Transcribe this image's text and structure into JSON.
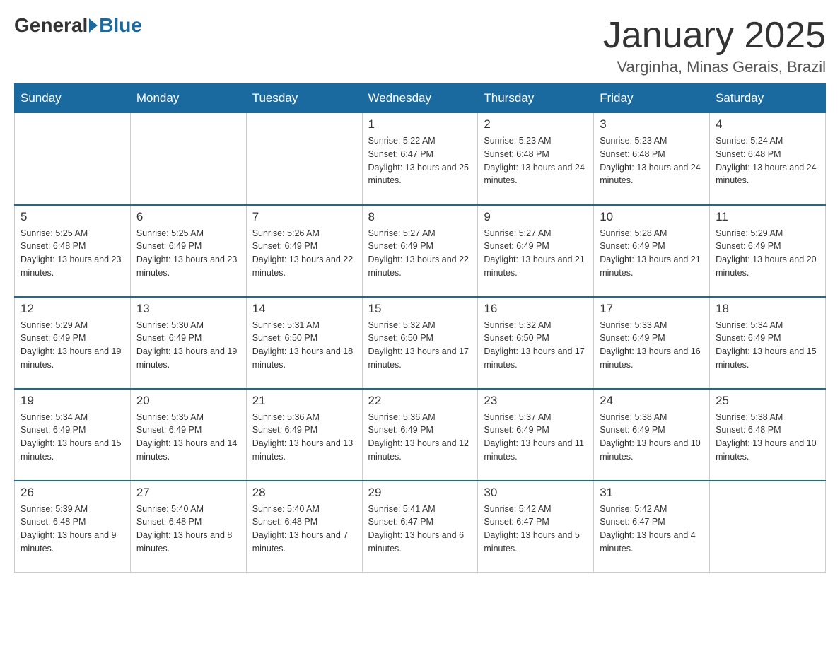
{
  "logo": {
    "general": "General",
    "blue": "Blue"
  },
  "title": "January 2025",
  "location": "Varginha, Minas Gerais, Brazil",
  "days_of_week": [
    "Sunday",
    "Monday",
    "Tuesday",
    "Wednesday",
    "Thursday",
    "Friday",
    "Saturday"
  ],
  "weeks": [
    [
      {
        "day": "",
        "info": ""
      },
      {
        "day": "",
        "info": ""
      },
      {
        "day": "",
        "info": ""
      },
      {
        "day": "1",
        "info": "Sunrise: 5:22 AM\nSunset: 6:47 PM\nDaylight: 13 hours and 25 minutes."
      },
      {
        "day": "2",
        "info": "Sunrise: 5:23 AM\nSunset: 6:48 PM\nDaylight: 13 hours and 24 minutes."
      },
      {
        "day": "3",
        "info": "Sunrise: 5:23 AM\nSunset: 6:48 PM\nDaylight: 13 hours and 24 minutes."
      },
      {
        "day": "4",
        "info": "Sunrise: 5:24 AM\nSunset: 6:48 PM\nDaylight: 13 hours and 24 minutes."
      }
    ],
    [
      {
        "day": "5",
        "info": "Sunrise: 5:25 AM\nSunset: 6:48 PM\nDaylight: 13 hours and 23 minutes."
      },
      {
        "day": "6",
        "info": "Sunrise: 5:25 AM\nSunset: 6:49 PM\nDaylight: 13 hours and 23 minutes."
      },
      {
        "day": "7",
        "info": "Sunrise: 5:26 AM\nSunset: 6:49 PM\nDaylight: 13 hours and 22 minutes."
      },
      {
        "day": "8",
        "info": "Sunrise: 5:27 AM\nSunset: 6:49 PM\nDaylight: 13 hours and 22 minutes."
      },
      {
        "day": "9",
        "info": "Sunrise: 5:27 AM\nSunset: 6:49 PM\nDaylight: 13 hours and 21 minutes."
      },
      {
        "day": "10",
        "info": "Sunrise: 5:28 AM\nSunset: 6:49 PM\nDaylight: 13 hours and 21 minutes."
      },
      {
        "day": "11",
        "info": "Sunrise: 5:29 AM\nSunset: 6:49 PM\nDaylight: 13 hours and 20 minutes."
      }
    ],
    [
      {
        "day": "12",
        "info": "Sunrise: 5:29 AM\nSunset: 6:49 PM\nDaylight: 13 hours and 19 minutes."
      },
      {
        "day": "13",
        "info": "Sunrise: 5:30 AM\nSunset: 6:49 PM\nDaylight: 13 hours and 19 minutes."
      },
      {
        "day": "14",
        "info": "Sunrise: 5:31 AM\nSunset: 6:50 PM\nDaylight: 13 hours and 18 minutes."
      },
      {
        "day": "15",
        "info": "Sunrise: 5:32 AM\nSunset: 6:50 PM\nDaylight: 13 hours and 17 minutes."
      },
      {
        "day": "16",
        "info": "Sunrise: 5:32 AM\nSunset: 6:50 PM\nDaylight: 13 hours and 17 minutes."
      },
      {
        "day": "17",
        "info": "Sunrise: 5:33 AM\nSunset: 6:49 PM\nDaylight: 13 hours and 16 minutes."
      },
      {
        "day": "18",
        "info": "Sunrise: 5:34 AM\nSunset: 6:49 PM\nDaylight: 13 hours and 15 minutes."
      }
    ],
    [
      {
        "day": "19",
        "info": "Sunrise: 5:34 AM\nSunset: 6:49 PM\nDaylight: 13 hours and 15 minutes."
      },
      {
        "day": "20",
        "info": "Sunrise: 5:35 AM\nSunset: 6:49 PM\nDaylight: 13 hours and 14 minutes."
      },
      {
        "day": "21",
        "info": "Sunrise: 5:36 AM\nSunset: 6:49 PM\nDaylight: 13 hours and 13 minutes."
      },
      {
        "day": "22",
        "info": "Sunrise: 5:36 AM\nSunset: 6:49 PM\nDaylight: 13 hours and 12 minutes."
      },
      {
        "day": "23",
        "info": "Sunrise: 5:37 AM\nSunset: 6:49 PM\nDaylight: 13 hours and 11 minutes."
      },
      {
        "day": "24",
        "info": "Sunrise: 5:38 AM\nSunset: 6:49 PM\nDaylight: 13 hours and 10 minutes."
      },
      {
        "day": "25",
        "info": "Sunrise: 5:38 AM\nSunset: 6:48 PM\nDaylight: 13 hours and 10 minutes."
      }
    ],
    [
      {
        "day": "26",
        "info": "Sunrise: 5:39 AM\nSunset: 6:48 PM\nDaylight: 13 hours and 9 minutes."
      },
      {
        "day": "27",
        "info": "Sunrise: 5:40 AM\nSunset: 6:48 PM\nDaylight: 13 hours and 8 minutes."
      },
      {
        "day": "28",
        "info": "Sunrise: 5:40 AM\nSunset: 6:48 PM\nDaylight: 13 hours and 7 minutes."
      },
      {
        "day": "29",
        "info": "Sunrise: 5:41 AM\nSunset: 6:47 PM\nDaylight: 13 hours and 6 minutes."
      },
      {
        "day": "30",
        "info": "Sunrise: 5:42 AM\nSunset: 6:47 PM\nDaylight: 13 hours and 5 minutes."
      },
      {
        "day": "31",
        "info": "Sunrise: 5:42 AM\nSunset: 6:47 PM\nDaylight: 13 hours and 4 minutes."
      },
      {
        "day": "",
        "info": ""
      }
    ]
  ]
}
